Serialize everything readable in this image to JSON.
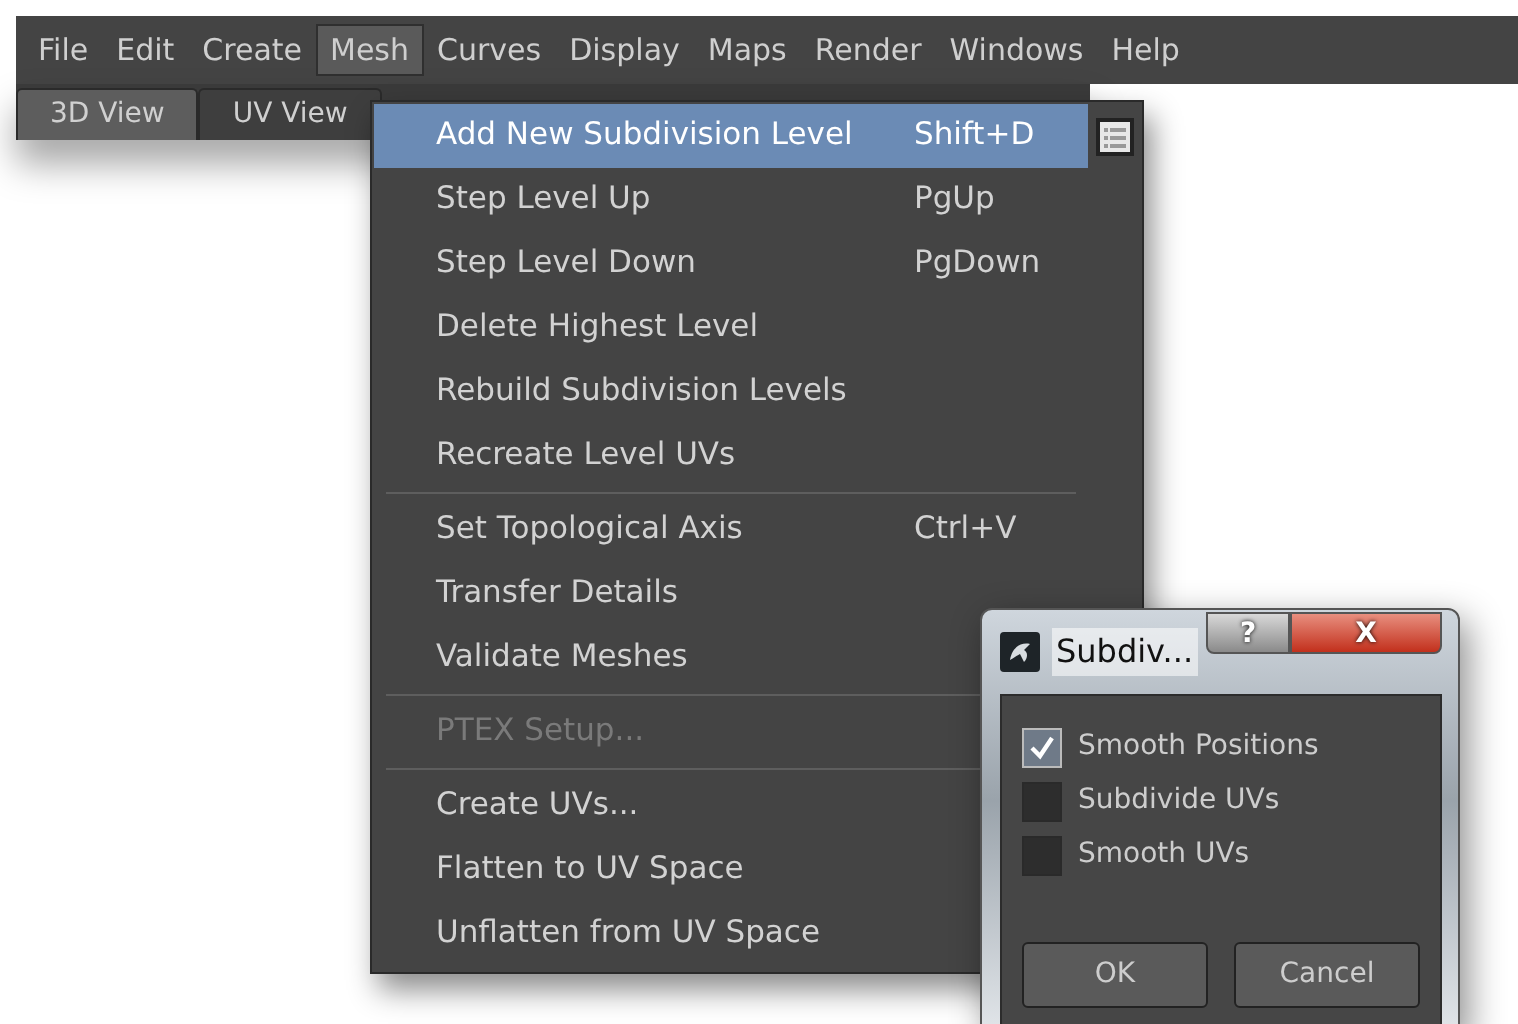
{
  "menubar": [
    {
      "label": "File",
      "selected": false
    },
    {
      "label": "Edit",
      "selected": false
    },
    {
      "label": "Create",
      "selected": false
    },
    {
      "label": "Mesh",
      "selected": true
    },
    {
      "label": "Curves",
      "selected": false
    },
    {
      "label": "Display",
      "selected": false
    },
    {
      "label": "Maps",
      "selected": false
    },
    {
      "label": "Render",
      "selected": false
    },
    {
      "label": "Windows",
      "selected": false
    },
    {
      "label": "Help",
      "selected": false
    }
  ],
  "tabs": [
    {
      "label": "3D View",
      "selected": true
    },
    {
      "label": "UV View",
      "selected": false
    }
  ],
  "menu": {
    "items": [
      {
        "kind": "item",
        "label": "Add New Subdivision Level",
        "shortcut": "Shift+D",
        "highlighted": true,
        "disabled": false,
        "option_box": true
      },
      {
        "kind": "item",
        "label": "Step Level Up",
        "shortcut": "PgUp",
        "highlighted": false,
        "disabled": false,
        "option_box": false
      },
      {
        "kind": "item",
        "label": "Step Level Down",
        "shortcut": "PgDown",
        "highlighted": false,
        "disabled": false,
        "option_box": false
      },
      {
        "kind": "item",
        "label": "Delete Highest Level",
        "highlighted": false,
        "disabled": false,
        "option_box": false
      },
      {
        "kind": "item",
        "label": "Rebuild Subdivision Levels",
        "highlighted": false,
        "disabled": false,
        "option_box": false
      },
      {
        "kind": "item",
        "label": "Recreate Level UVs",
        "highlighted": false,
        "disabled": false,
        "option_box": false
      },
      {
        "kind": "separator"
      },
      {
        "kind": "item",
        "label": "Set Topological Axis",
        "shortcut": "Ctrl+V",
        "highlighted": false,
        "disabled": false,
        "option_box": false
      },
      {
        "kind": "item",
        "label": "Transfer Details",
        "highlighted": false,
        "disabled": false,
        "option_box": false
      },
      {
        "kind": "item",
        "label": "Validate Meshes",
        "highlighted": false,
        "disabled": false,
        "option_box": false
      },
      {
        "kind": "separator"
      },
      {
        "kind": "item",
        "label": "PTEX Setup...",
        "highlighted": false,
        "disabled": true,
        "option_box": false
      },
      {
        "kind": "separator"
      },
      {
        "kind": "item",
        "label": "Create UVs...",
        "highlighted": false,
        "disabled": false,
        "option_box": false
      },
      {
        "kind": "item",
        "label": "Flatten to UV Space",
        "highlighted": false,
        "disabled": false,
        "option_box": false
      },
      {
        "kind": "item",
        "label": "Unflatten from UV Space",
        "highlighted": false,
        "disabled": false,
        "option_box": false
      }
    ]
  },
  "dialog": {
    "title": "Subdiv...",
    "help": "?",
    "close": "X",
    "options": [
      {
        "label": "Smooth Positions",
        "checked": true
      },
      {
        "label": "Subdivide UVs",
        "checked": false
      },
      {
        "label": "Smooth UVs",
        "checked": false
      }
    ],
    "buttons": [
      "OK",
      "Cancel"
    ]
  }
}
